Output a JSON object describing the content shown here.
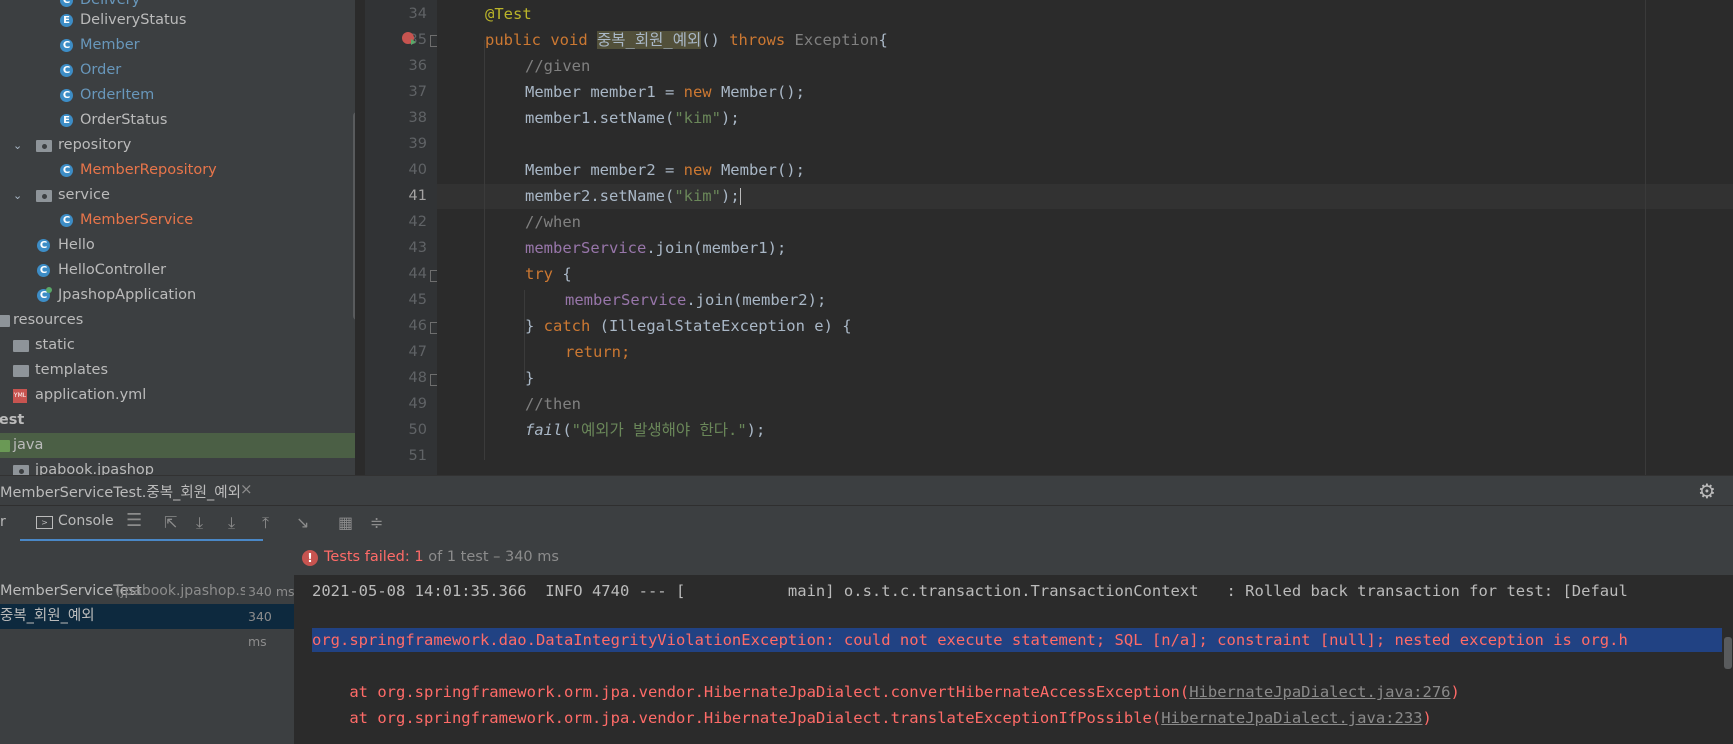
{
  "project_tree": {
    "items": [
      {
        "label": "DeliveryStatus",
        "type": "class",
        "color": "#bbbbbb"
      },
      {
        "label": "Member",
        "type": "class",
        "color": "#6897bb"
      },
      {
        "label": "Order",
        "type": "class",
        "color": "#6897bb"
      },
      {
        "label": "OrderItem",
        "type": "class",
        "color": "#6897bb"
      },
      {
        "label": "OrderStatus",
        "type": "class",
        "color": "#bbbbbb"
      },
      {
        "label": "repository",
        "type": "package"
      },
      {
        "label": "MemberRepository",
        "type": "class",
        "color": "#e8754a"
      },
      {
        "label": "service",
        "type": "package"
      },
      {
        "label": "MemberService",
        "type": "class",
        "color": "#e8754a"
      },
      {
        "label": "Hello",
        "type": "class"
      },
      {
        "label": "HelloController",
        "type": "class"
      },
      {
        "label": "JpashopApplication",
        "type": "class"
      },
      {
        "label": "resources",
        "type": "folder"
      },
      {
        "label": "static",
        "type": "folder"
      },
      {
        "label": "templates",
        "type": "folder"
      },
      {
        "label": "application.yml",
        "type": "yml"
      },
      {
        "label": "test",
        "type": "folder"
      },
      {
        "label": "java",
        "type": "source"
      },
      {
        "label": "jpabook.jpashop",
        "type": "package"
      }
    ]
  },
  "editor": {
    "current_line": "41",
    "lines": [
      {
        "n": "34"
      },
      {
        "n": "35"
      },
      {
        "n": "36"
      },
      {
        "n": "37"
      },
      {
        "n": "38"
      },
      {
        "n": "39"
      },
      {
        "n": "40"
      },
      {
        "n": "41"
      },
      {
        "n": "42"
      },
      {
        "n": "43"
      },
      {
        "n": "44"
      },
      {
        "n": "45"
      },
      {
        "n": "46"
      },
      {
        "n": "47"
      },
      {
        "n": "48"
      },
      {
        "n": "49"
      },
      {
        "n": "50"
      },
      {
        "n": "51"
      }
    ],
    "code": {
      "l34": "@Test",
      "l35_kw": "public void ",
      "l35_name": "중복_회원_예외",
      "l35_rest1": "() ",
      "l35_throws": "throws ",
      "l35_exc": "Exception",
      "l35_brace": "{",
      "l36": "//given",
      "l37_a": "Member member1 = ",
      "l37_new": "new ",
      "l37_b": "Member();",
      "l38_a": "member1.setName(",
      "l38_str": "\"kim\"",
      "l38_b": ");",
      "l40_a": "Member member2 = ",
      "l40_new": "new ",
      "l40_b": "Member();",
      "l41_a": "member2.setName(",
      "l41_str": "\"kim\"",
      "l41_b": ");",
      "l42": "//when",
      "l43_fld": "memberService",
      "l43_b": ".join(member1);",
      "l44_kw": "try ",
      "l44_b": "{",
      "l45_fld": "memberService",
      "l45_b": ".join(member2);",
      "l46_a": "} ",
      "l46_kw": "catch ",
      "l46_b": "(IllegalStateException e) {",
      "l47": "return;",
      "l48": "}",
      "l49": "//then",
      "l50_fn": "fail",
      "l50_a": "(",
      "l50_str": "\"예외가 발생해야 한다.\"",
      "l50_b": ");"
    }
  },
  "run_panel": {
    "tab_title": "MemberServiceTest.중복_회원_예외",
    "console_tab": "Console",
    "status_text_prefix": "Tests failed: ",
    "status_failed": "1",
    "status_text_suffix": " of 1 test – 340 ms",
    "tests": [
      {
        "name": "MemberServiceTest",
        "pkg": " (jpabook.jpashop.se",
        "time": "340 ms"
      },
      {
        "name": "중복_회원_예외",
        "time": "340 ms"
      }
    ],
    "console": {
      "info_line": "2021-05-08 14:01:35.366  INFO 4740 --- [           main] o.s.t.c.transaction.TransactionContext   : Rolled back transaction for test: [Defaul",
      "exception_line": "org.springframework.dao.DataIntegrityViolationException: could not execute statement; SQL [n/a]; constraint [null]; nested exception is org.h",
      "trace1_a": "    at org.springframework.orm.jpa.vendor.HibernateJpaDialect.convertHibernateAccessException(",
      "trace1_link": "HibernateJpaDialect.java:276",
      "trace1_b": ")",
      "trace2_a": "    at org.springframework.orm.jpa.vendor.HibernateJpaDialect.translateExceptionIfPossible(",
      "trace2_link": "HibernateJpaDialect.java:233",
      "trace2_b": ")"
    }
  },
  "colors": {
    "error": "#ff6b68",
    "keyword": "#cc7832",
    "string": "#6a8759",
    "annotation": "#bbb529",
    "selection": "#214283"
  }
}
